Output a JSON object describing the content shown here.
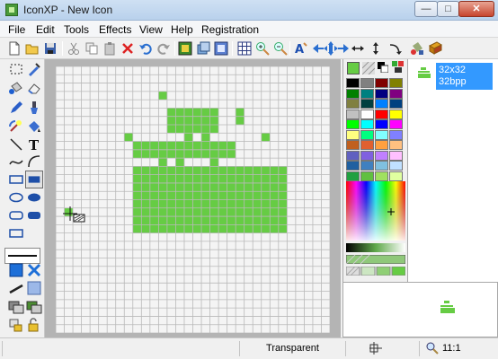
{
  "window": {
    "title": "IconXP - New Icon",
    "min_glyph": "—",
    "max_glyph": "□",
    "close_glyph": "✕"
  },
  "menu": [
    "File",
    "Edit",
    "Tools",
    "Effects",
    "View",
    "Help",
    "Registration"
  ],
  "toolbar": [
    "new-icon",
    "open-icon",
    "save-icon",
    "cut-icon",
    "copy-icon",
    "paste-icon",
    "delete-icon",
    "undo-icon",
    "redo-icon",
    "import-icon",
    "export-icon",
    "capture-icon",
    "grid-icon",
    "zoom-in-icon",
    "zoom-out-icon",
    "text-icon",
    "move-left-icon",
    "move-all-icon",
    "move-right-icon",
    "flip-horizontal-icon",
    "flip-vertical-icon",
    "rotate-icon",
    "fill-icon",
    "library-icon"
  ],
  "tools": [
    "select-rect-tool",
    "picker-tool",
    "fill-tool",
    "eraser-tool",
    "pencil-tool",
    "brush-tool",
    "magic-wand-tool",
    "bucket-tool",
    "line-tool",
    "text-tool",
    "curve-tool",
    "arc-tool",
    "rectangle-tool",
    "filled-rectangle-tool",
    "ellipse-tool",
    "filled-ellipse-tool",
    "rounded-rect-tool",
    "filled-rounded-rect-tool",
    "rect-outline-tool"
  ],
  "colors": {
    "primary": "#66cc44",
    "secondary": "#ffffff",
    "swatches": [
      "#000000",
      "#808080",
      "#800000",
      "#808000",
      "#008000",
      "#008080",
      "#000080",
      "#800080",
      "#808040",
      "#004040",
      "#0080ff",
      "#004080",
      "#c0c0c0",
      "#ffffff",
      "#ff0000",
      "#ffff00",
      "#00ff00",
      "#00ffff",
      "#0000ff",
      "#ff00ff",
      "#ffff80",
      "#00ff80",
      "#80ffff",
      "#8080ff",
      "#c06020",
      "#e06030",
      "#ffa040",
      "#ffc080",
      "#6060c0",
      "#8060e0",
      "#c080ff",
      "#ffc0ff",
      "#2060a0",
      "#4080c0",
      "#80c0e0",
      "#c0e0ff",
      "#20a040",
      "#60c040",
      "#a0e060",
      "#e0ffa0"
    ]
  },
  "icon_format": {
    "size": "32x32",
    "depth": "32bpp"
  },
  "status": {
    "color_label": "Transparent",
    "zoom": "11:1"
  }
}
